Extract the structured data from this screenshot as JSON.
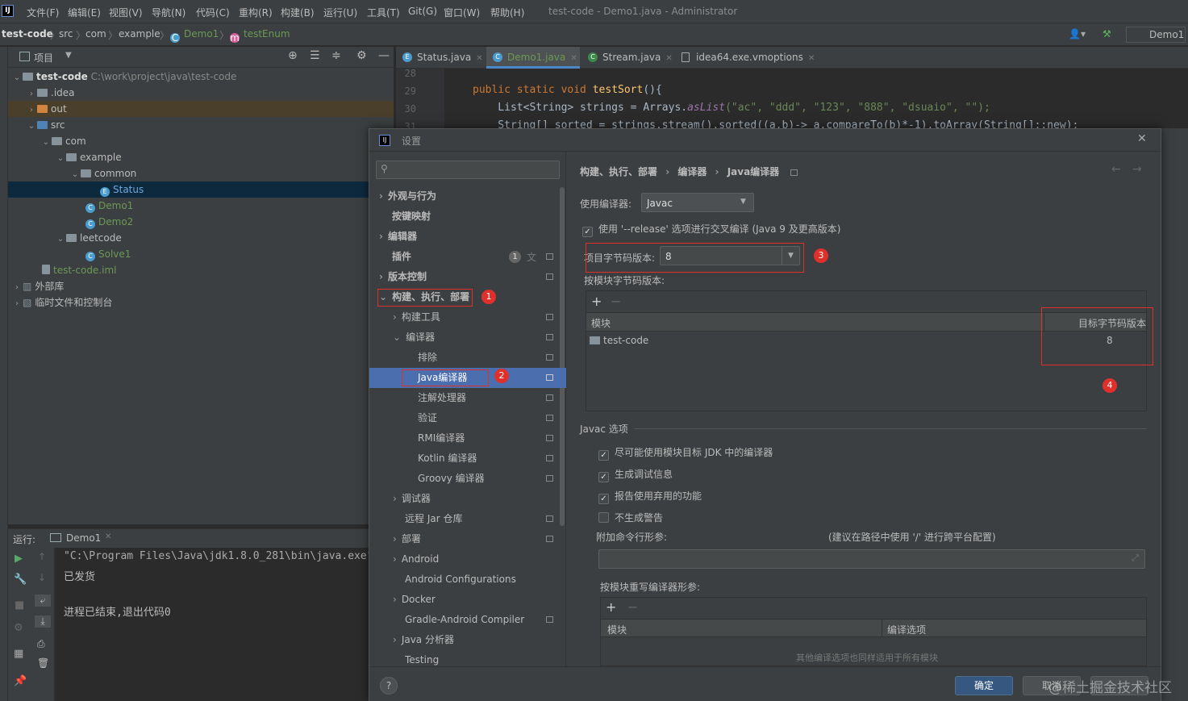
{
  "menubar": {
    "items": [
      "文件(F)",
      "编辑(E)",
      "视图(V)",
      "导航(N)",
      "代码(C)",
      "重构(R)",
      "构建(B)",
      "运行(U)",
      "工具(T)",
      "Git(G)",
      "窗口(W)",
      "帮助(H)"
    ],
    "window_title": "test-code - Demo1.java - Administrator"
  },
  "breadcrumb": [
    "test-code",
    "src",
    "com",
    "example",
    "Demo1",
    "testEnum"
  ],
  "toolbar": {
    "run_config": "Demo1"
  },
  "project_panel": {
    "title": "项目",
    "root_name": "test-code",
    "root_path": "C:\\work\\project\\java\\test-code",
    "tree": [
      {
        "label": "test-code",
        "indent": 0,
        "type": "root"
      },
      {
        "label": ".idea",
        "indent": 1,
        "type": "folder"
      },
      {
        "label": "out",
        "indent": 1,
        "type": "folder-orange"
      },
      {
        "label": "src",
        "indent": 1,
        "type": "folder-blue"
      },
      {
        "label": "com",
        "indent": 2,
        "type": "folder"
      },
      {
        "label": "example",
        "indent": 3,
        "type": "folder"
      },
      {
        "label": "common",
        "indent": 4,
        "type": "folder"
      },
      {
        "label": "Status",
        "indent": 5,
        "type": "enum",
        "selected": true
      },
      {
        "label": "Demo1",
        "indent": 4,
        "type": "class"
      },
      {
        "label": "Demo2",
        "indent": 4,
        "type": "class"
      },
      {
        "label": "leetcode",
        "indent": 3,
        "type": "folder"
      },
      {
        "label": "Solve1",
        "indent": 4,
        "type": "class"
      },
      {
        "label": "test-code.iml",
        "indent": 2,
        "type": "iml"
      },
      {
        "label": "外部库",
        "indent": 0,
        "type": "lib"
      },
      {
        "label": "临时文件和控制台",
        "indent": 0,
        "type": "scratch"
      }
    ]
  },
  "editor_tabs": [
    {
      "label": "Status.java",
      "icon": "E",
      "active": false
    },
    {
      "label": "Demo1.java",
      "icon": "C",
      "active": true
    },
    {
      "label": "Stream.java",
      "icon": "C",
      "active": false
    },
    {
      "label": "idea64.exe.vmoptions",
      "icon": "file",
      "active": false
    }
  ],
  "editor": {
    "line_numbers": [
      "28",
      "29",
      "30",
      "31"
    ],
    "line29_kw": "public static void ",
    "line29_fn": "testSort",
    "line29_rest": "(){",
    "line30_a": "    List<String> strings = Arrays.",
    "line30_it": "asList",
    "line30_b": "(\"ac\", \"ddd\", \"123\", \"888\", \"dsuaio\", \"\");",
    "line31": "    String[] sorted = strings.stream().sorted((a,b)-> a.compareTo(b)*-1).toArray(String[]::new);"
  },
  "run_panel": {
    "label": "运行:",
    "tab": "Demo1",
    "output": [
      "\"C:\\Program Files\\Java\\jdk1.8.0_281\\bin\\java.exe\"",
      "已发货",
      "",
      "进程已结束,退出代码0"
    ]
  },
  "dialog": {
    "title": "设置",
    "search_placeholder": "",
    "breadcrumb": [
      "构建、执行、部署",
      "编译器",
      "Java编译器"
    ],
    "tree": [
      {
        "label": "外观与行为",
        "bold": true,
        "arrow": ">",
        "indent": 0
      },
      {
        "label": "按键映射",
        "bold": true,
        "arrow": "",
        "indent": 0
      },
      {
        "label": "编辑器",
        "bold": true,
        "arrow": ">",
        "indent": 0
      },
      {
        "label": "插件",
        "bold": true,
        "arrow": "",
        "indent": 0,
        "badge": "1"
      },
      {
        "label": "版本控制",
        "bold": true,
        "arrow": ">",
        "indent": 0
      },
      {
        "label": "构建、执行、部署",
        "bold": true,
        "arrow": "v",
        "indent": 0
      },
      {
        "label": "构建工具",
        "arrow": ">",
        "indent": 1
      },
      {
        "label": "编译器",
        "arrow": "v",
        "indent": 1
      },
      {
        "label": "排除",
        "arrow": "",
        "indent": 2
      },
      {
        "label": "Java编译器",
        "arrow": "",
        "indent": 2,
        "selected": true
      },
      {
        "label": "注解处理器",
        "arrow": "",
        "indent": 2
      },
      {
        "label": "验证",
        "arrow": "",
        "indent": 2
      },
      {
        "label": "RMI编译器",
        "arrow": "",
        "indent": 2
      },
      {
        "label": "Kotlin 编译器",
        "arrow": "",
        "indent": 2
      },
      {
        "label": "Groovy 编译器",
        "arrow": "",
        "indent": 2
      },
      {
        "label": "调试器",
        "arrow": ">",
        "indent": 1
      },
      {
        "label": "远程 Jar 仓库",
        "arrow": "",
        "indent": 1
      },
      {
        "label": "部署",
        "arrow": ">",
        "indent": 1
      },
      {
        "label": "Android",
        "arrow": ">",
        "indent": 1
      },
      {
        "label": "Android Configurations",
        "arrow": "",
        "indent": 1
      },
      {
        "label": "Docker",
        "arrow": ">",
        "indent": 1
      },
      {
        "label": "Gradle-Android Compiler",
        "arrow": "",
        "indent": 1
      },
      {
        "label": "Java 分析器",
        "arrow": ">",
        "indent": 1
      },
      {
        "label": "Testing",
        "arrow": "",
        "indent": 1
      }
    ],
    "use_compiler_label": "使用编译器:",
    "use_compiler_value": "Javac",
    "release_option": "使用 '--release' 选项进行交叉编译 (Java 9 及更高版本)",
    "project_bytecode_label": "项目字节码版本:",
    "project_bytecode_value": "8",
    "per_module_label": "按模块字节码版本:",
    "module_table": {
      "col_module": "模块",
      "col_target": "目标字节码版本",
      "rows": [
        {
          "module": "test-code",
          "target": "8"
        }
      ]
    },
    "javac_section": "Javac 选项",
    "javac_options": [
      {
        "label": "尽可能使用模块目标 JDK 中的编译器",
        "checked": true
      },
      {
        "label": "生成调试信息",
        "checked": true
      },
      {
        "label": "报告使用弃用的功能",
        "checked": true
      },
      {
        "label": "不生成警告",
        "checked": false
      }
    ],
    "extra_args_label": "附加命令行形参:",
    "extra_args_hint": "(建议在路径中使用 '/' 进行跨平台配置)",
    "override_label": "按模块重写编译器形参:",
    "override_table": {
      "col_module": "模块",
      "col_options": "编译选项",
      "empty_text": "其他编译选项也同样适用于所有模块"
    },
    "ok_button": "确定",
    "cancel_button": "取消",
    "badges": [
      "1",
      "2",
      "3",
      "4"
    ]
  },
  "watermark": "@稀土掘金技术社区",
  "colors": {
    "accent": "#4b6eaf",
    "annotation_red": "#e0302c",
    "primary_button": "#365880"
  }
}
